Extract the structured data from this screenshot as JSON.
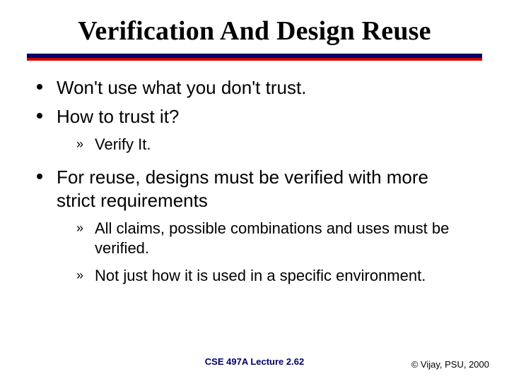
{
  "title": "Verification And Design Reuse",
  "bullets": {
    "b1": "Won't use what you don't trust.",
    "b2": "How to trust it?",
    "b2_sub1": "Verify It.",
    "b3": "For reuse, designs must be verified with more strict requirements",
    "b3_sub1": "All claims, possible combinations and uses must be verified.",
    "b3_sub2": "Not just how it is used in a specific environment."
  },
  "footer": {
    "center": "CSE 497A Lecture 2.62",
    "right": "© Vijay, PSU, 2000"
  },
  "glyphs": {
    "raquo": "»"
  },
  "colors": {
    "accent_navy": "#000066",
    "accent_red": "#cc0000"
  }
}
